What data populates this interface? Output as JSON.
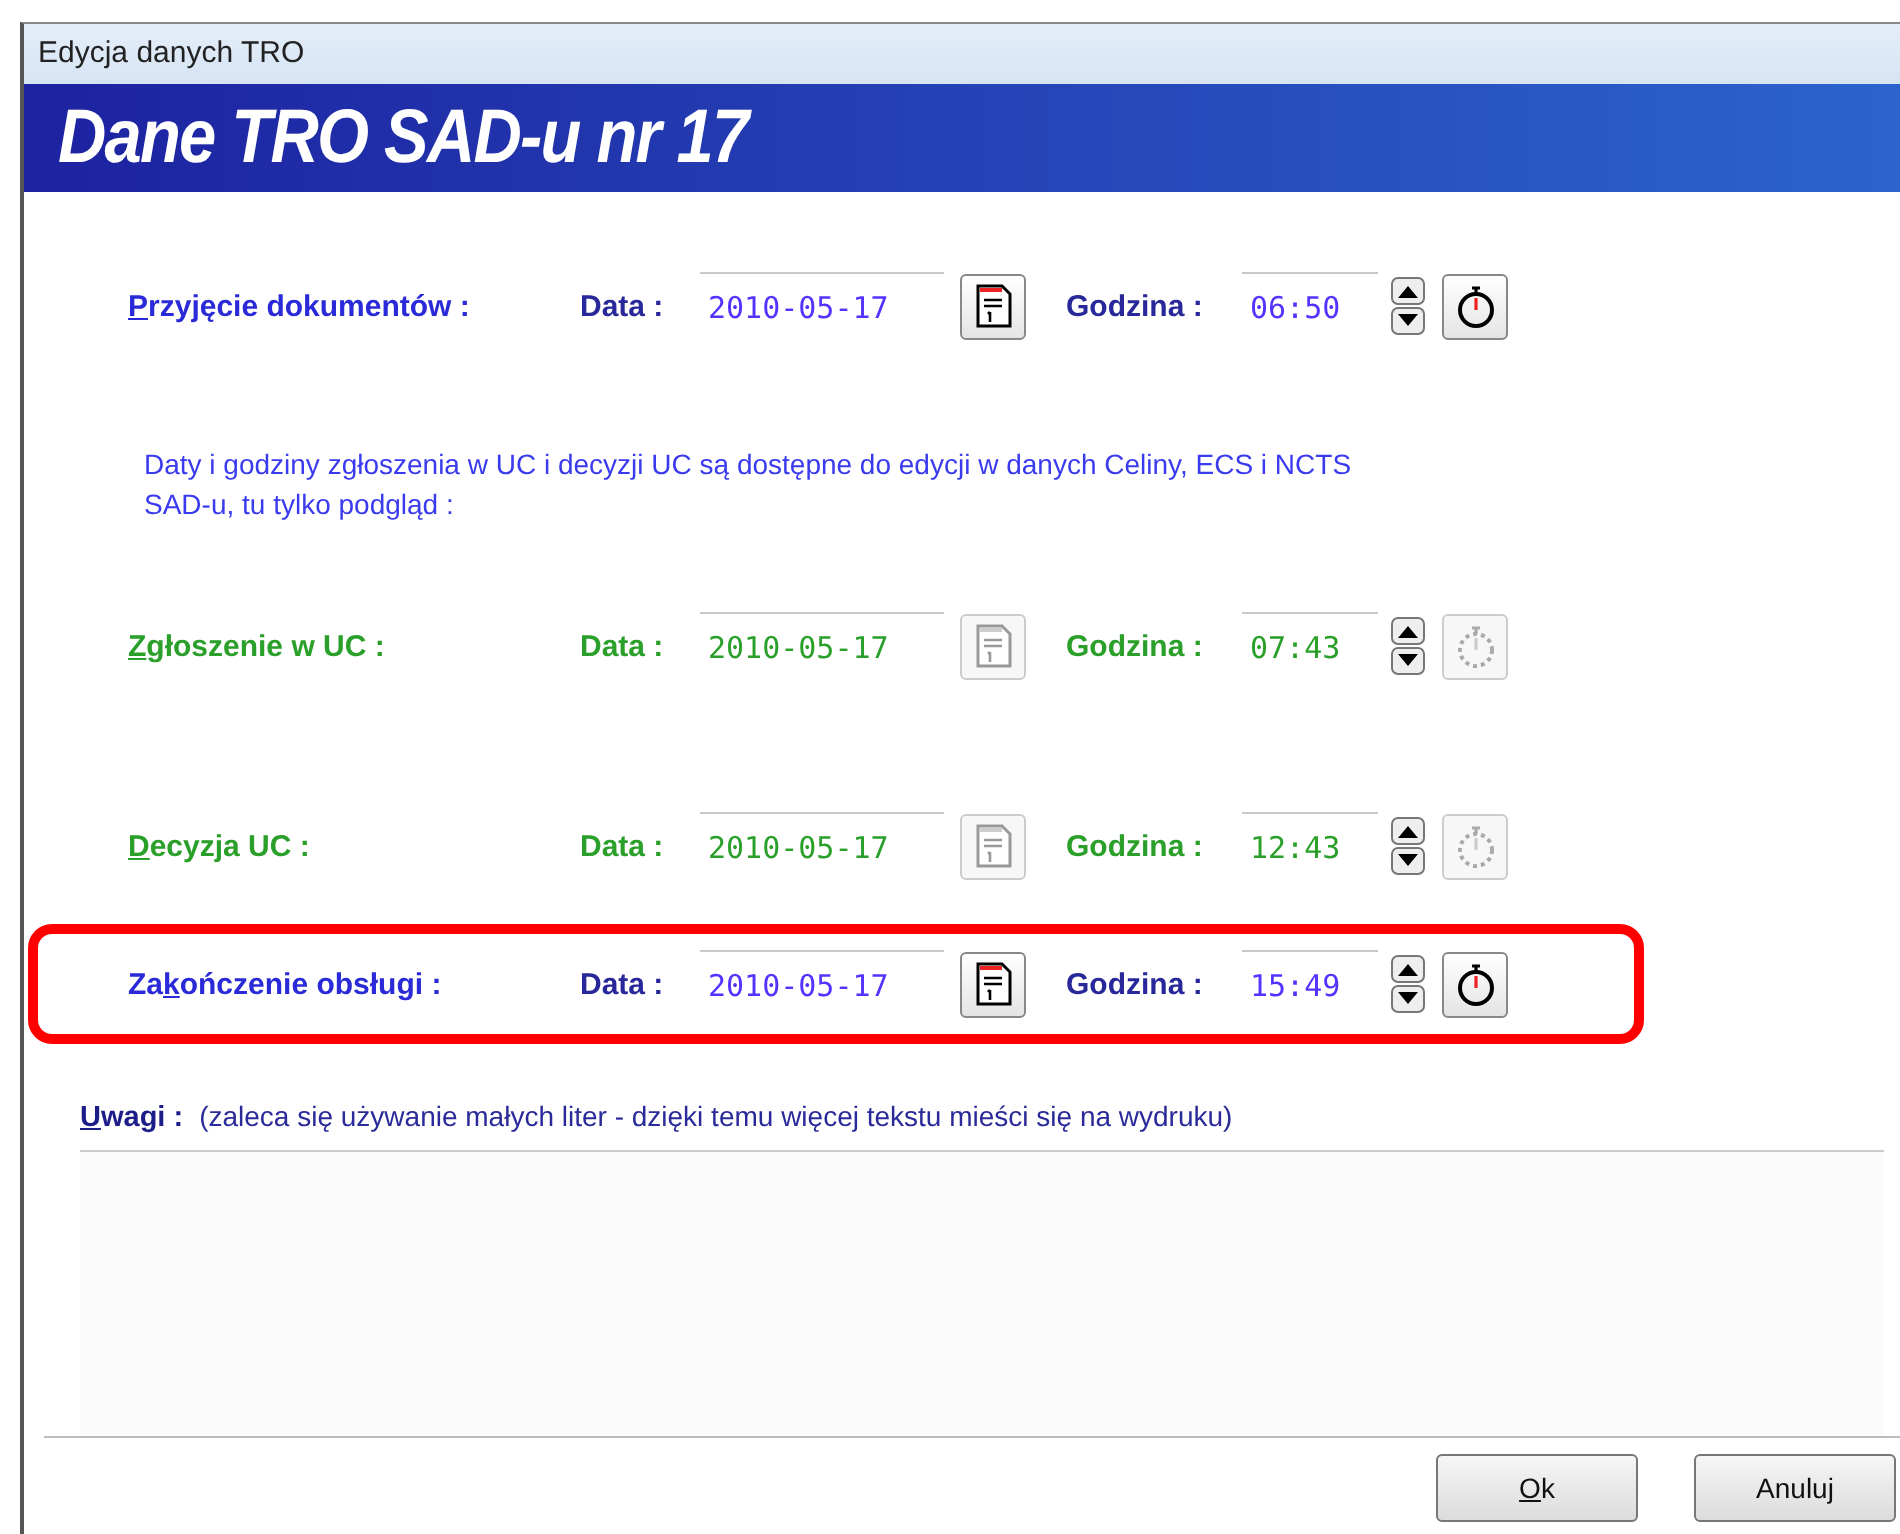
{
  "window": {
    "title": "Edycja danych TRO"
  },
  "banner": "Dane TRO SAD-u nr 17",
  "rows": [
    {
      "label": {
        "key": "P",
        "post": "rzyjęcie dokumentów :"
      },
      "date_label": "Data :",
      "date": "2010-05-17",
      "time_label": "Godzina :",
      "time": "06:50",
      "disabled": false,
      "highlighted": false
    },
    {
      "label": {
        "key": "Z",
        "post": "głoszenie w UC :"
      },
      "date_label": "Data :",
      "date": "2010-05-17",
      "time_label": "Godzina :",
      "time": "07:43",
      "disabled": true,
      "highlighted": false
    },
    {
      "label": {
        "key": "D",
        "post": "ecyzja UC :"
      },
      "date_label": "Data :",
      "date": "2010-05-17",
      "time_label": "Godzina :",
      "time": "12:43",
      "disabled": true,
      "highlighted": false
    },
    {
      "label": {
        "pre": "Za",
        "key": "k",
        "post": "ończenie obsługi :"
      },
      "date_label": "Data :",
      "date": "2010-05-17",
      "time_label": "Godzina :",
      "time": "15:49",
      "disabled": false,
      "highlighted": true
    }
  ],
  "note": "Daty i godziny zgłoszenia w UC i decyzji UC są dostępne do edycji w danych Celiny, ECS i NCTS SAD-u, tu tylko podgląd :",
  "remarks": {
    "label": {
      "key": "U",
      "post": "wagi :"
    },
    "hint": "(zaleca się używanie małych liter - dzięki temu więcej tekstu mieści się na wydruku)"
  },
  "buttons": [
    {
      "label": {
        "key": "O",
        "post": "k"
      }
    },
    {
      "label": {
        "post": "Anuluj"
      }
    }
  ]
}
